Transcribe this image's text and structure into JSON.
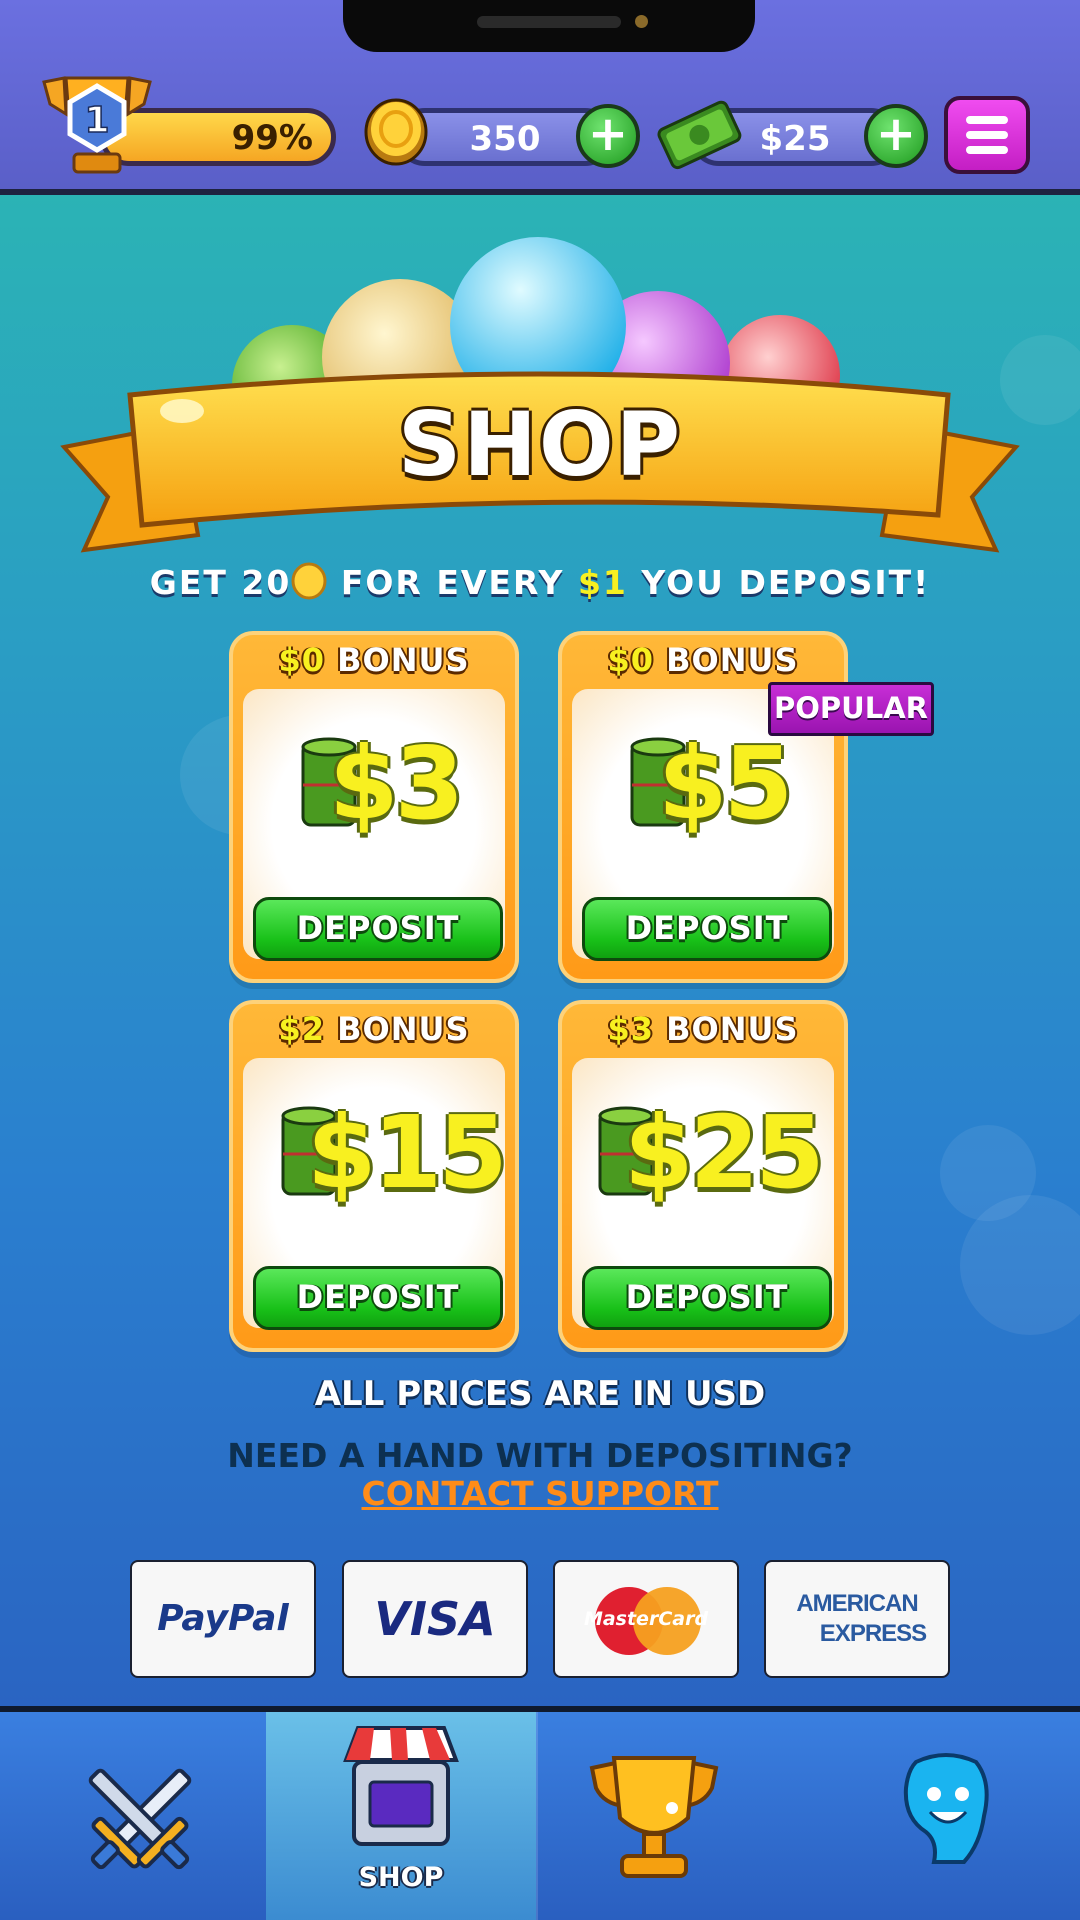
{
  "header": {
    "level": "1",
    "xp_percent_label": "99%",
    "coins": "350",
    "cash": "$25"
  },
  "banner": {
    "title": "SHOP"
  },
  "promo": {
    "part1": "GET 20",
    "part2": " FOR EVERY ",
    "amount": "$1",
    "part3": " YOU DEPOSIT!"
  },
  "offers": [
    {
      "bonus_amount": "$0",
      "bonus_label": " BONUS",
      "price": "$3",
      "button": "DEPOSIT"
    },
    {
      "bonus_amount": "$0",
      "bonus_label": " BONUS",
      "price": "$5",
      "button": "DEPOSIT",
      "badge": "POPULAR"
    },
    {
      "bonus_amount": "$2",
      "bonus_label": " BONUS",
      "price": "$15",
      "button": "DEPOSIT"
    },
    {
      "bonus_amount": "$3",
      "bonus_label": " BONUS",
      "price": "$25",
      "button": "DEPOSIT"
    }
  ],
  "footer": {
    "usd_note": "ALL PRICES ARE IN USD",
    "help_text": "NEED A HAND WITH DEPOSITING?",
    "support_link": "CONTACT SUPPORT"
  },
  "payment_methods": {
    "paypal": "PayPal",
    "visa": "VISA",
    "mastercard": "MasterCard",
    "amex_line1": "AMERICAN",
    "amex_line2": "EXPRESS"
  },
  "nav": {
    "items": [
      "swords-icon",
      "shop-icon",
      "trophy-icon",
      "profile-icon"
    ],
    "active_label": "SHOP"
  },
  "colors": {
    "accent_yellow": "#f8f020",
    "deposit_green": "#18c018",
    "popular_purple": "#c72ed6",
    "support_orange": "#ff8c18"
  }
}
